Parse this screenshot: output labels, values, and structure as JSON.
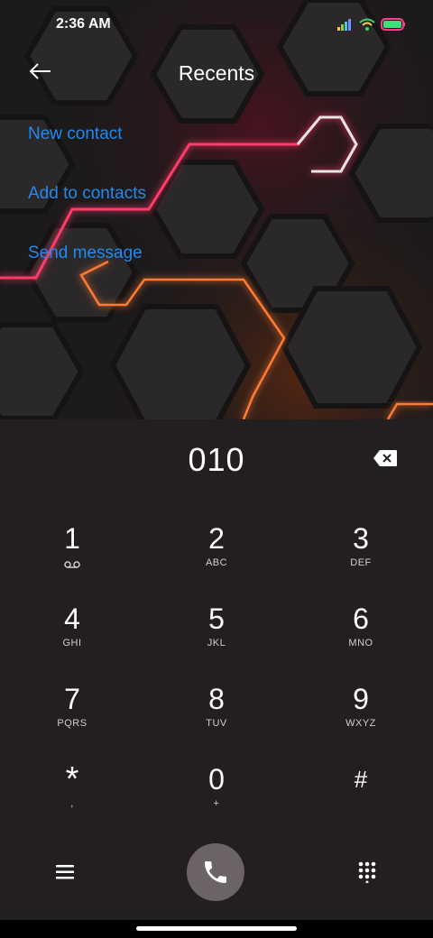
{
  "status_bar": {
    "time": "2:36 AM",
    "icons": [
      "signal-icon",
      "wifi-icon",
      "battery-icon"
    ]
  },
  "header": {
    "title": "Recents",
    "back_icon": "back-arrow-icon"
  },
  "actions": [
    "New contact",
    "Add to contacts",
    "Send message"
  ],
  "dialer": {
    "number": "010",
    "keys": [
      {
        "digit": "1",
        "sub": ""
      },
      {
        "digit": "2",
        "sub": "ABC"
      },
      {
        "digit": "3",
        "sub": "DEF"
      },
      {
        "digit": "4",
        "sub": "GHI"
      },
      {
        "digit": "5",
        "sub": "JKL"
      },
      {
        "digit": "6",
        "sub": "MNO"
      },
      {
        "digit": "7",
        "sub": "PQRS"
      },
      {
        "digit": "8",
        "sub": "TUV"
      },
      {
        "digit": "9",
        "sub": "WXYZ"
      },
      {
        "digit": "*",
        "sub": ","
      },
      {
        "digit": "0",
        "sub": "+"
      },
      {
        "digit": "#",
        "sub": ""
      }
    ]
  },
  "bottom": {
    "menu_icon": "menu-icon",
    "call_icon": "phone-icon",
    "keypad_icon": "dialpad-icon"
  },
  "colors": {
    "accent": "#1f8bf0",
    "panel": "#231f20",
    "call_button": "#6b6366"
  }
}
